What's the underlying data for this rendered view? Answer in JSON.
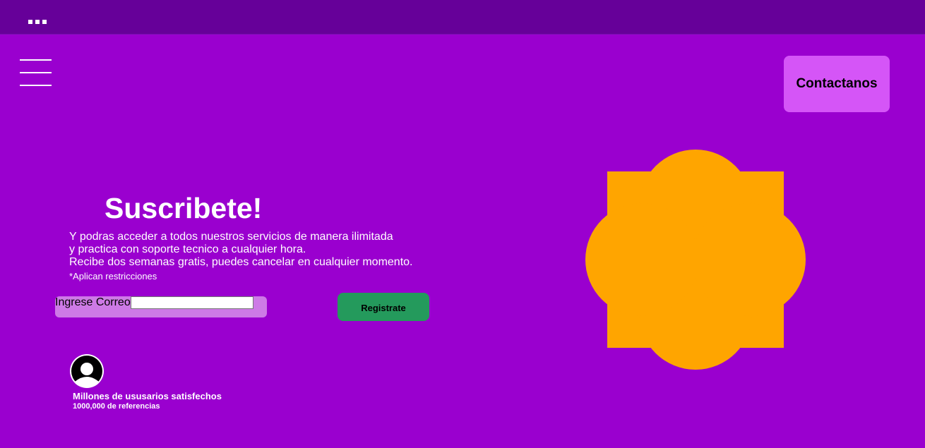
{
  "header": {
    "menu_icon": "more-dots-icon"
  },
  "nav": {
    "menu_icon": "hamburger-icon",
    "contact_label": "Contactanos"
  },
  "hero": {
    "title": "Suscribete!",
    "lines": [
      "Y podras acceder a todos nuestros servicios de manera ilimitada",
      "y practica con soporte tecnico a cualquier hora.",
      "Recibe dos semanas gratis, puedes cancelar en cualquier momento."
    ],
    "note": "*Aplican restricciones"
  },
  "form": {
    "email_label": "Ingrese Correo",
    "email_value": "",
    "register_label": "Registrate"
  },
  "social_proof": {
    "avatar_icon": "user-avatar-icon",
    "title": "Millones de ususarios satisfechos",
    "subtitle": "1000,000 de referencias"
  },
  "colors": {
    "background": "#9a00cf",
    "topbar": "#660099",
    "contact_button": "#d555f7",
    "register_button": "#249a5c",
    "email_box": "#cd7ae6",
    "shape": "#ffa500"
  }
}
